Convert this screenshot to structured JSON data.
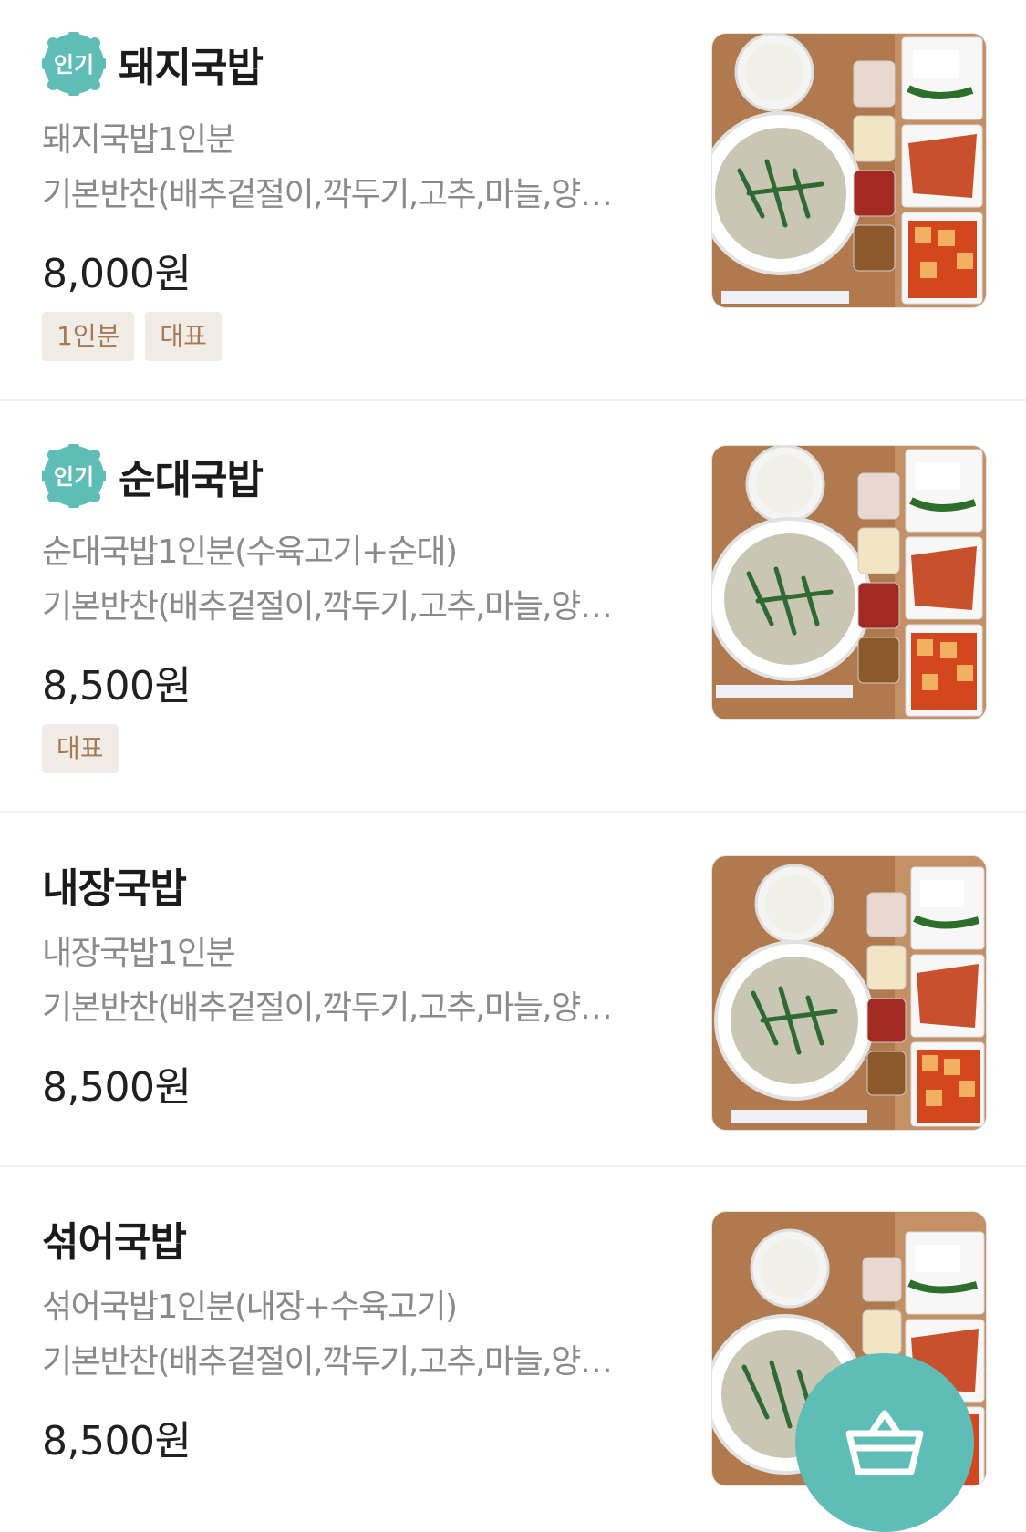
{
  "menu": {
    "items": [
      {
        "badge": "인기",
        "name": "돼지국밥",
        "desc1": "돼지국밥1인분",
        "desc2": "기본반찬(배추겉절이,깍두기,고추,마늘,양…",
        "price": "8,000원",
        "tags": [
          "1인분",
          "대표"
        ],
        "image_alt": "돼지국밥"
      },
      {
        "badge": "인기",
        "name": "순대국밥",
        "desc1": "순대국밥1인분(수육고기+순대)",
        "desc2": "기본반찬(배추겉절이,깍두기,고추,마늘,양…",
        "price": "8,500원",
        "tags": [
          "대표"
        ],
        "image_alt": "순대국밥"
      },
      {
        "badge": "",
        "name": "내장국밥",
        "desc1": "내장국밥1인분",
        "desc2": "기본반찬(배추겉절이,깍두기,고추,마늘,양…",
        "price": "8,500원",
        "tags": [],
        "image_alt": "내장국밥"
      },
      {
        "badge": "",
        "name": "섞어국밥",
        "desc1": "섞어국밥1인분(내장+수육고기)",
        "desc2": "기본반찬(배추겉절이,깍두기,고추,마늘,양…",
        "price": "8,500원",
        "tags": [],
        "image_alt": "섞어국밥"
      }
    ]
  },
  "colors": {
    "accent": "#5fbdb8",
    "tag_bg": "#f2ece6",
    "tag_text": "#a47a56"
  },
  "icons": {
    "popular_badge": "scalloped-badge-icon",
    "cart": "basket-icon"
  }
}
